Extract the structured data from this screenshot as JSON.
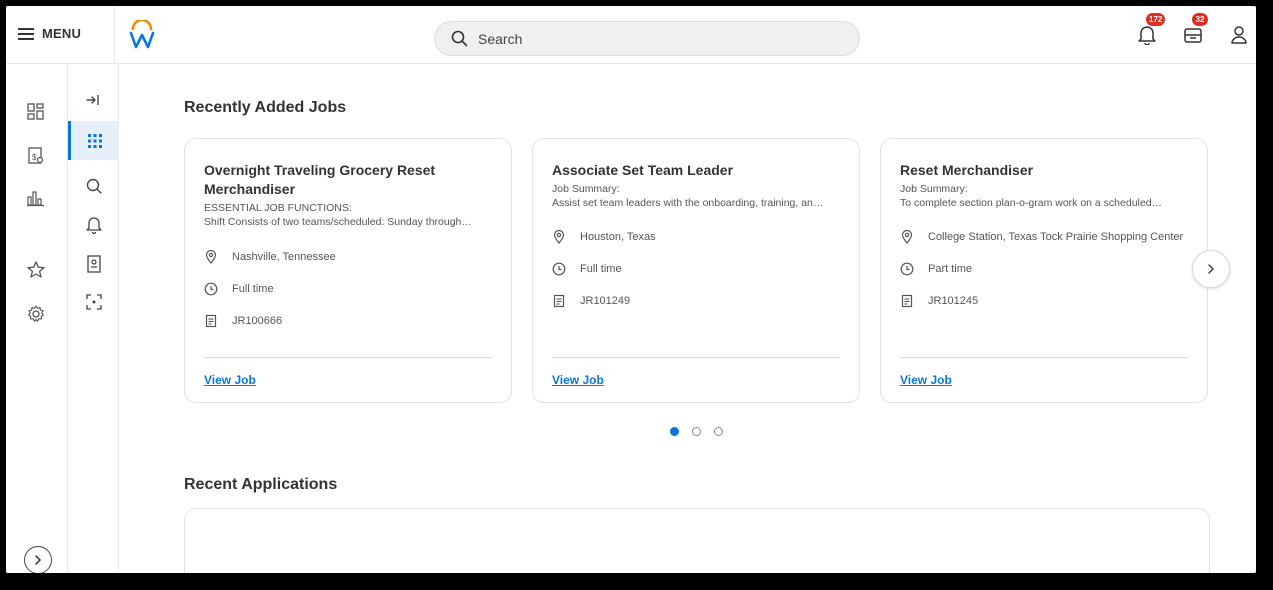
{
  "topbar": {
    "menu_label": "MENU",
    "search_placeholder": "Search",
    "notifications_count": "172",
    "inbox_count": "32"
  },
  "sections": {
    "recent_jobs_title": "Recently Added Jobs",
    "recent_applications_title": "Recent Applications"
  },
  "jobs": [
    {
      "title": "Overnight Traveling Grocery Reset Merchandiser",
      "summary_label": "ESSENTIAL JOB FUNCTIONS:",
      "summary_text": "Shift Consists of two teams/scheduled: Sunday through…",
      "location": "Nashville, Tennessee",
      "time_type": "Full time",
      "req_id": "JR100666",
      "link": "View Job"
    },
    {
      "title": "Associate Set Team Leader",
      "summary_label": "Job Summary:",
      "summary_text": "Assist set team leaders with the onboarding, training, an…",
      "location": "Houston, Texas",
      "time_type": "Full time",
      "req_id": "JR101249",
      "link": "View Job"
    },
    {
      "title": "Reset Merchandiser",
      "summary_label": "Job Summary:",
      "summary_text": "To complete section plan-o-gram work on a scheduled…",
      "location": "College Station, Texas Tock Prairie Shopping Center",
      "time_type": "Part time",
      "req_id": "JR101245",
      "link": "View Job"
    }
  ],
  "carousel": {
    "pages": 3,
    "active_page": 1
  },
  "colors": {
    "accent": "#0875e1",
    "badge": "#de2e21",
    "logo_orange": "#f38b00",
    "logo_blue": "#0875e1"
  },
  "icons": {
    "rail1": [
      "dashboard-icon",
      "career-icon",
      "analytics-icon",
      "favorites-star-icon",
      "settings-gear-icon"
    ],
    "rail2": [
      "collapse-icon",
      "apps-grid-icon",
      "search-icon",
      "bell-icon",
      "profile-card-icon",
      "scan-icon"
    ]
  }
}
